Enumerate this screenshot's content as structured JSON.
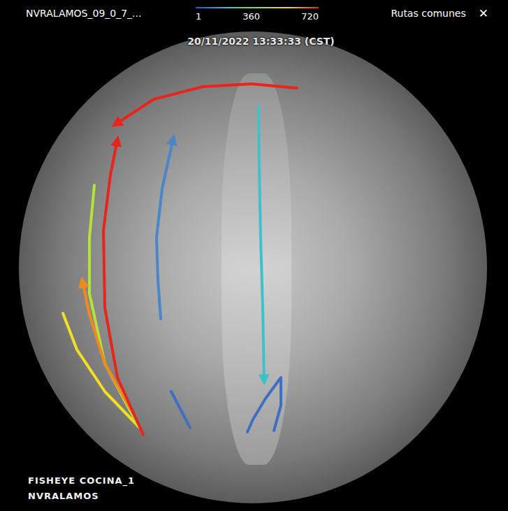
{
  "header": {
    "title": "NVRALAMOS_09_0_7_...",
    "legend": {
      "ticks": [
        "1",
        "360",
        "720"
      ]
    },
    "mode_label": "Rutas comunes",
    "close": "✕"
  },
  "camera": {
    "timestamp": "20/11/2022 13:33:33 (CST)",
    "name": "FISHEYE COCINA_1",
    "site": "NVRALAMOS"
  },
  "routes": [
    {
      "color": "#f0e020",
      "arrow": false,
      "points": [
        [
          200,
          612
        ],
        [
          150,
          560
        ],
        [
          110,
          500
        ],
        [
          90,
          448
        ]
      ]
    },
    {
      "color": "#b5e23a",
      "arrow": false,
      "points": [
        [
          196,
          606
        ],
        [
          150,
          520
        ],
        [
          128,
          420
        ],
        [
          128,
          340
        ],
        [
          135,
          265
        ]
      ]
    },
    {
      "color": "#f08a1c",
      "arrow": true,
      "points": [
        [
          194,
          598
        ],
        [
          150,
          520
        ],
        [
          128,
          450
        ],
        [
          118,
          402
        ]
      ]
    },
    {
      "color": "#e8241c",
      "arrow": true,
      "points": [
        [
          205,
          622
        ],
        [
          168,
          540
        ],
        [
          150,
          440
        ],
        [
          148,
          330
        ],
        [
          158,
          250
        ],
        [
          168,
          200
        ]
      ]
    },
    {
      "color": "#e8241c",
      "arrow": true,
      "points": [
        [
          425,
          126
        ],
        [
          360,
          120
        ],
        [
          290,
          124
        ],
        [
          220,
          142
        ],
        [
          165,
          178
        ]
      ]
    },
    {
      "color": "#4a86c8",
      "arrow": true,
      "points": [
        [
          230,
          456
        ],
        [
          226,
          400
        ],
        [
          224,
          340
        ],
        [
          232,
          270
        ],
        [
          248,
          198
        ]
      ]
    },
    {
      "color": "#3fc1c9",
      "arrow": true,
      "points": [
        [
          370,
          152
        ],
        [
          371,
          240
        ],
        [
          373,
          340
        ],
        [
          376,
          440
        ],
        [
          378,
          545
        ]
      ]
    },
    {
      "color": "#3f6fc0",
      "arrow": false,
      "points": [
        [
          392,
          616
        ],
        [
          402,
          580
        ],
        [
          402,
          540
        ],
        [
          380,
          570
        ],
        [
          362,
          600
        ],
        [
          354,
          618
        ]
      ]
    },
    {
      "color": "#3f6fc0",
      "arrow": false,
      "points": [
        [
          272,
          612
        ],
        [
          258,
          585
        ],
        [
          245,
          560
        ]
      ]
    }
  ]
}
